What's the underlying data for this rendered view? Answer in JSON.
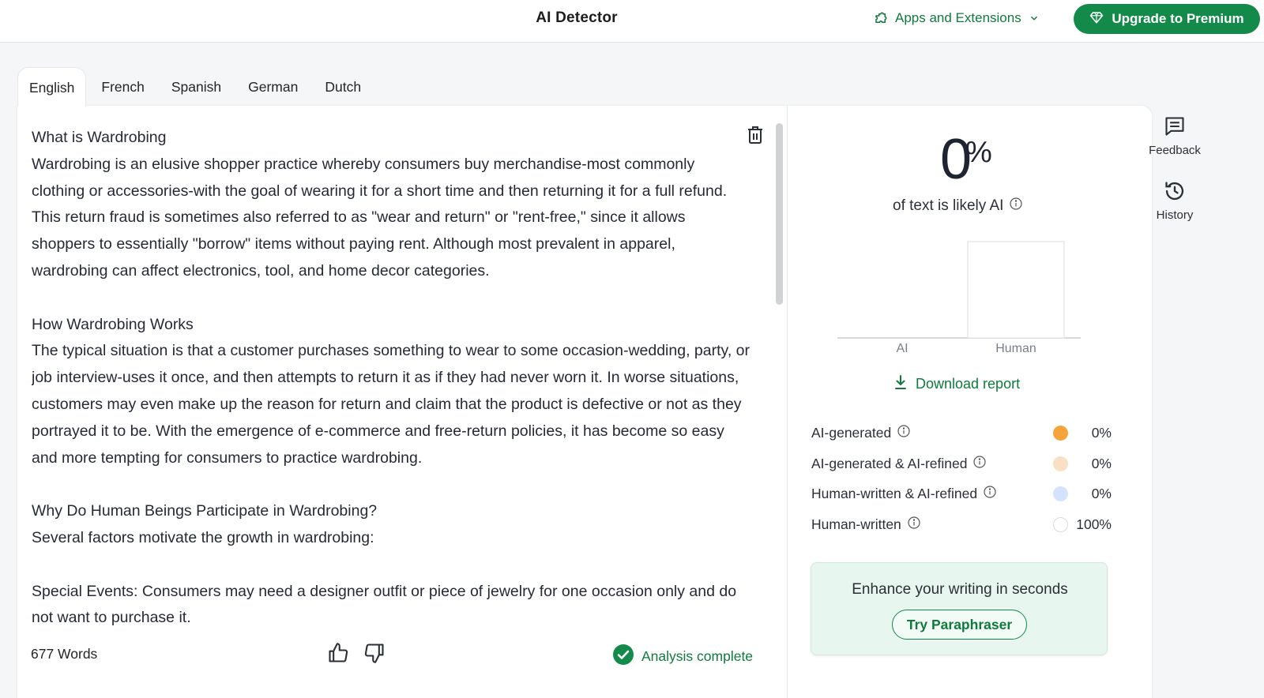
{
  "header": {
    "title": "AI Detector",
    "apps_label": "Apps and Extensions",
    "upgrade_label": "Upgrade to Premium"
  },
  "tabs": [
    {
      "label": "English",
      "active": true
    },
    {
      "label": "French",
      "active": false
    },
    {
      "label": "Spanish",
      "active": false
    },
    {
      "label": "German",
      "active": false
    },
    {
      "label": "Dutch",
      "active": false
    }
  ],
  "editor": {
    "paragraphs": [
      "What is Wardrobing",
      "Wardrobing is an elusive shopper practice whereby consumers buy merchandise-most commonly clothing or accessories-with the goal of wearing it for a short time and then returning it for a full refund. This return fraud is sometimes also referred to as \"wear and return\" or \"rent-free,\" since it allows shoppers to essentially \"borrow\" items without paying rent. Although most prevalent in apparel, wardrobing can affect electronics, tool, and home decor categories.",
      "",
      "How Wardrobing Works",
      "The typical situation is that a customer purchases something to wear to some occasion-wedding, party, or job interview-uses it once, and then attempts to return it as if they had never worn it. In worse situations, customers may even make up the reason for return and claim that the product is defective or not as they portrayed it to be. With the emergence of e-commerce and free-return policies, it has become so easy and more tempting for consumers to practice wardrobing.",
      "",
      "Why Do Human Beings Participate in Wardrobing?",
      "Several factors motivate the growth in wardrobing:",
      "",
      "Special Events: Consumers may need a designer outfit or piece of jewelry for one occasion only and do not want to purchase it."
    ],
    "word_count": "677 Words",
    "status": "Analysis complete"
  },
  "results": {
    "percent_value": "0",
    "percent_sign": "%",
    "likely_label": "of text is likely AI",
    "download_label": "Download report",
    "chart_data": {
      "type": "bar",
      "categories": [
        "AI",
        "Human"
      ],
      "values": [
        0,
        100
      ],
      "ylim": [
        0,
        100
      ]
    },
    "legend": [
      {
        "label": "AI-generated",
        "value": "0%",
        "color": "#f5a33a"
      },
      {
        "label": "AI-generated & AI-refined",
        "value": "0%",
        "color": "#f9e0c4"
      },
      {
        "label": "Human-written & AI-refined",
        "value": "0%",
        "color": "#d3e3fb"
      },
      {
        "label": "Human-written",
        "value": "100%",
        "color": "#ffffff"
      }
    ],
    "promo_text": "Enhance your writing in seconds",
    "promo_button": "Try Paraphraser"
  },
  "rail": {
    "feedback_label": "Feedback",
    "history_label": "History"
  }
}
